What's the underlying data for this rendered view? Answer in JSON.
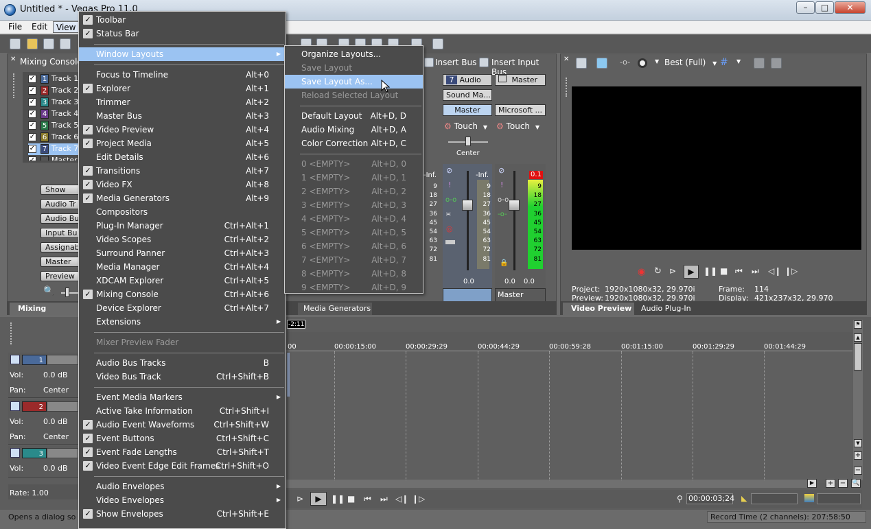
{
  "window": {
    "title": "Untitled * - Vegas Pro 11.0"
  },
  "menubar": {
    "file": "File",
    "edit": "Edit",
    "view": "View"
  },
  "mixing_panel": {
    "header": "Mixing Console",
    "tab_label": "Mixing Console",
    "tracks": [
      {
        "num": "1",
        "name": "Track 1",
        "color": "#4a6a9a"
      },
      {
        "num": "2",
        "name": "Track 2",
        "color": "#9a2a2a"
      },
      {
        "num": "3",
        "name": "Track 3",
        "color": "#2a8a8a"
      },
      {
        "num": "4",
        "name": "Track 4",
        "color": "#6a3a8a"
      },
      {
        "num": "5",
        "name": "Track 5",
        "color": "#2a7a4a"
      },
      {
        "num": "6",
        "name": "Track 6",
        "color": "#8a7a2a"
      },
      {
        "num": "7",
        "name": "Track 7",
        "color": "#3a4a7a"
      },
      {
        "num": "",
        "name": "Master",
        "color": "#555555"
      }
    ],
    "side_buttons": [
      "Show",
      "Audio Tr",
      "Audio Bu",
      "Input Bu",
      "Assignab",
      "Master",
      "Preview"
    ]
  },
  "mixer": {
    "insert_bus": "Insert Bus",
    "insert_input_bus": "Insert Input Bus",
    "audio_num": "7",
    "audio_label": "Audio",
    "master_label": "Master",
    "sound_mapper": "Sound Ma...",
    "master_btn": "Master",
    "microsoft_btn": "Microsoft ...",
    "touch1": "Touch",
    "touch2": "Touch",
    "center": "Center",
    "neg_inf_left": "-Inf.",
    "neg_inf_right": "-Inf.",
    "peak_master": "0.1",
    "meter_scale": [
      "9",
      "18",
      "27",
      "36",
      "45",
      "54",
      "63",
      "72",
      "81"
    ],
    "val_audio": "0.0",
    "val_master_l": "0.0",
    "val_master_r": "0.0",
    "strip_footer_master": "Master",
    "tab_media_generators": "Media Generators"
  },
  "preview_panel": {
    "quality": "Best (Full)",
    "project_label": "Project:",
    "project_value": "1920x1080x32, 29.970i",
    "preview_label": "Preview:",
    "preview_value": "1920x1080x32, 29.970i",
    "frame_label": "Frame:",
    "frame_value": "114",
    "display_label": "Display:",
    "display_value": "421x237x32, 29.970",
    "tab_video_preview": "Video Preview",
    "tab_audio_plugin": "Audio Plug-In"
  },
  "timeline": {
    "cursor_label": "-2:11",
    "ruler": [
      "00:00:15:00",
      "00:00:29:29",
      "00:00:44:29",
      "00:00:59:28",
      "00:01:15:00",
      "00:01:29:29",
      "00:01:44:29"
    ],
    "ruler_first": "00",
    "track_headers": [
      {
        "num": "1",
        "vol_label": "Vol:",
        "vol": "0.0 dB",
        "pan_label": "Pan:",
        "pan": "Center",
        "color": "#4a6a9a"
      },
      {
        "num": "2",
        "vol_label": "Vol:",
        "vol": "0.0 dB",
        "pan_label": "Pan:",
        "pan": "Center",
        "color": "#9a2a2a"
      },
      {
        "num": "3",
        "vol_label": "Vol:",
        "vol": "0.0 dB",
        "color": "#2a8a8a"
      }
    ],
    "rate": "Rate: 1.00",
    "time_display": "00:00:03;24"
  },
  "statusbar": {
    "hint": "Opens a dialog so yo",
    "record_time": "Record Time (2 channels): 207:58:50"
  },
  "view_menu": {
    "items": [
      {
        "label": "Toolbar",
        "checked": true
      },
      {
        "label": "Status Bar",
        "checked": true
      },
      {
        "sep": true
      },
      {
        "label": "Window Layouts",
        "submenu": true,
        "highlight": true
      },
      {
        "sep": true
      },
      {
        "label": "Focus to Timeline",
        "shortcut": "Alt+0"
      },
      {
        "label": "Explorer",
        "shortcut": "Alt+1",
        "checked": true
      },
      {
        "label": "Trimmer",
        "shortcut": "Alt+2"
      },
      {
        "label": "Master Bus",
        "shortcut": "Alt+3"
      },
      {
        "label": "Video Preview",
        "shortcut": "Alt+4",
        "checked": true
      },
      {
        "label": "Project Media",
        "shortcut": "Alt+5",
        "checked": true
      },
      {
        "label": "Edit Details",
        "shortcut": "Alt+6"
      },
      {
        "label": "Transitions",
        "shortcut": "Alt+7",
        "checked": true
      },
      {
        "label": "Video FX",
        "shortcut": "Alt+8",
        "checked": true
      },
      {
        "label": "Media Generators",
        "shortcut": "Alt+9",
        "checked": true
      },
      {
        "label": "Compositors"
      },
      {
        "label": "Plug-In Manager",
        "shortcut": "Ctrl+Alt+1"
      },
      {
        "label": "Video Scopes",
        "shortcut": "Ctrl+Alt+2"
      },
      {
        "label": "Surround Panner",
        "shortcut": "Ctrl+Alt+3"
      },
      {
        "label": "Media Manager",
        "shortcut": "Ctrl+Alt+4"
      },
      {
        "label": "XDCAM Explorer",
        "shortcut": "Ctrl+Alt+5"
      },
      {
        "label": "Mixing Console",
        "shortcut": "Ctrl+Alt+6",
        "checked": true
      },
      {
        "label": "Device Explorer",
        "shortcut": "Ctrl+Alt+7"
      },
      {
        "label": "Extensions",
        "submenu": true
      },
      {
        "sep": true
      },
      {
        "label": "Mixer Preview Fader",
        "disabled": true
      },
      {
        "sep": true
      },
      {
        "label": "Audio Bus Tracks",
        "shortcut": "B"
      },
      {
        "label": "Video Bus Track",
        "shortcut": "Ctrl+Shift+B"
      },
      {
        "sep": true
      },
      {
        "label": "Event Media Markers",
        "submenu": true
      },
      {
        "label": "Active Take Information",
        "shortcut": "Ctrl+Shift+I"
      },
      {
        "label": "Audio Event Waveforms",
        "shortcut": "Ctrl+Shift+W",
        "checked": true
      },
      {
        "label": "Event Buttons",
        "shortcut": "Ctrl+Shift+C",
        "checked": true
      },
      {
        "label": "Event Fade Lengths",
        "shortcut": "Ctrl+Shift+T",
        "checked": true
      },
      {
        "label": "Video Event Edge Edit Frames",
        "shortcut": "Ctrl+Shift+O",
        "checked": true
      },
      {
        "sep": true
      },
      {
        "label": "Audio Envelopes",
        "submenu": true
      },
      {
        "label": "Video Envelopes",
        "submenu": true
      },
      {
        "label": "Show Envelopes",
        "shortcut": "Ctrl+Shift+E",
        "checked": true
      }
    ]
  },
  "layouts_submenu": {
    "items": [
      {
        "label": "Organize Layouts..."
      },
      {
        "label": "Save Layout",
        "disabled": true
      },
      {
        "label": "Save Layout As...",
        "highlight": true
      },
      {
        "label": "Reload Selected Layout",
        "disabled": true
      },
      {
        "sep": true
      },
      {
        "label": "Default Layout",
        "shortcut": "Alt+D, D"
      },
      {
        "label": "Audio Mixing",
        "shortcut": "Alt+D, A"
      },
      {
        "label": "Color Correction",
        "shortcut": "Alt+D, C"
      },
      {
        "sep": true
      },
      {
        "label": "0 <EMPTY>",
        "shortcut": "Alt+D, 0",
        "disabled": true
      },
      {
        "label": "1 <EMPTY>",
        "shortcut": "Alt+D, 1",
        "disabled": true
      },
      {
        "label": "2 <EMPTY>",
        "shortcut": "Alt+D, 2",
        "disabled": true
      },
      {
        "label": "3 <EMPTY>",
        "shortcut": "Alt+D, 3",
        "disabled": true
      },
      {
        "label": "4 <EMPTY>",
        "shortcut": "Alt+D, 4",
        "disabled": true
      },
      {
        "label": "5 <EMPTY>",
        "shortcut": "Alt+D, 5",
        "disabled": true
      },
      {
        "label": "6 <EMPTY>",
        "shortcut": "Alt+D, 6",
        "disabled": true
      },
      {
        "label": "7 <EMPTY>",
        "shortcut": "Alt+D, 7",
        "disabled": true
      },
      {
        "label": "8 <EMPTY>",
        "shortcut": "Alt+D, 8",
        "disabled": true
      },
      {
        "label": "9 <EMPTY>",
        "shortcut": "Alt+D, 9",
        "disabled": true
      }
    ]
  }
}
